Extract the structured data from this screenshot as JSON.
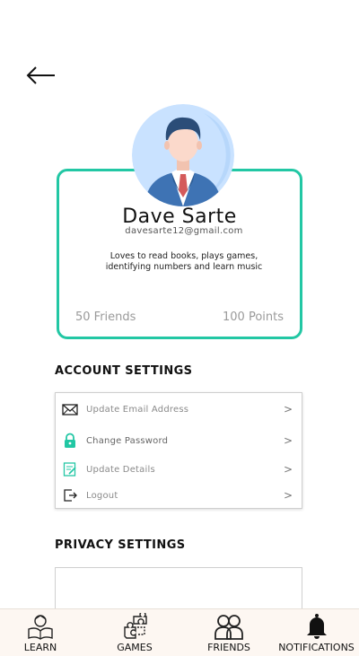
{
  "profile": {
    "name": "Dave Sarte",
    "email": "davesarte12@gmail.com",
    "bio": "Loves to read books, plays games, identifying numbers and learn music",
    "friends": "50 Friends",
    "points": "100 Points"
  },
  "account_settings": {
    "title": "ACCOUNT SETTINGS",
    "items": [
      {
        "label": "Update Email Address",
        "icon": "envelope-icon"
      },
      {
        "label": "Change Password",
        "icon": "lock-icon"
      },
      {
        "label": "Update Details",
        "icon": "edit-details-icon"
      },
      {
        "label": "Logout",
        "icon": "logout-icon"
      }
    ],
    "chevron": ">"
  },
  "privacy_settings": {
    "title": "PRIVACY SETTINGS"
  },
  "bottom_nav": {
    "items": [
      {
        "label": "LEARN",
        "icon": "learn-icon"
      },
      {
        "label": "GAMES",
        "icon": "puzzle-icon"
      },
      {
        "label": "FRIENDS",
        "icon": "friends-icon"
      },
      {
        "label": "NOTIFICATIONS",
        "icon": "bell-icon"
      }
    ]
  },
  "colors": {
    "accent": "#22c7a4",
    "avatar_bg": "#c9e2ff",
    "nav_bg": "#fdf7f2"
  }
}
